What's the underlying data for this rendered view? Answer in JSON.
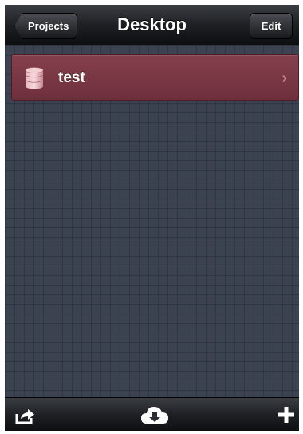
{
  "navbar": {
    "title": "Desktop",
    "back_label": "Projects",
    "edit_label": "Edit"
  },
  "projects": [
    {
      "name": "test",
      "icon": "database-icon",
      "color": "#7a3544"
    }
  ],
  "toolbar": {
    "icons": [
      "share-icon",
      "cloud-download-icon",
      "add-icon"
    ]
  }
}
